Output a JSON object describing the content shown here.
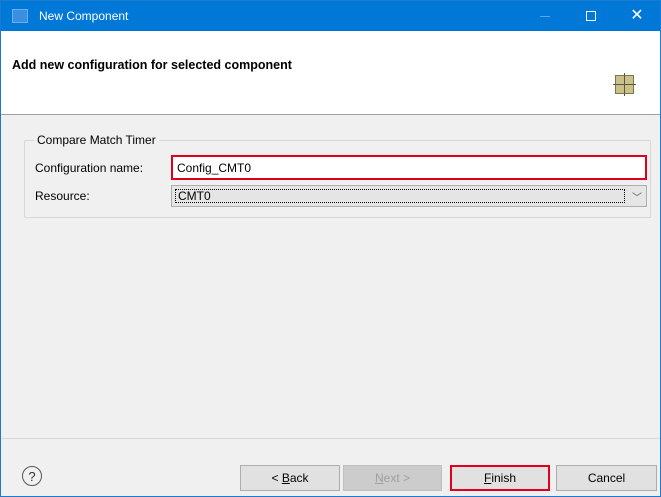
{
  "window": {
    "title": "New Component"
  },
  "banner": {
    "title": "Add new configuration for selected component"
  },
  "group": {
    "legend": "Compare Match Timer",
    "config_label": "Configuration name:",
    "config_value": "Config_CMT0",
    "resource_label": "Resource:",
    "resource_value": "CMT0"
  },
  "buttons": {
    "help": "?",
    "back_prefix": "< ",
    "back_mnemonic": "B",
    "back_rest": "ack",
    "next_mnemonic": "N",
    "next_rest": "ext >",
    "finish_mnemonic": "F",
    "finish_rest": "inish",
    "cancel": "Cancel"
  },
  "icons": {
    "app": "app-icon",
    "minimize": "minimize-icon",
    "maximize": "maximize-icon",
    "close": "close-icon",
    "component": "component-grid-icon",
    "dropdown": "chevron-down-icon",
    "help": "help-icon"
  },
  "colors": {
    "titlebar": "#0078d7",
    "highlight": "#e0001b"
  }
}
